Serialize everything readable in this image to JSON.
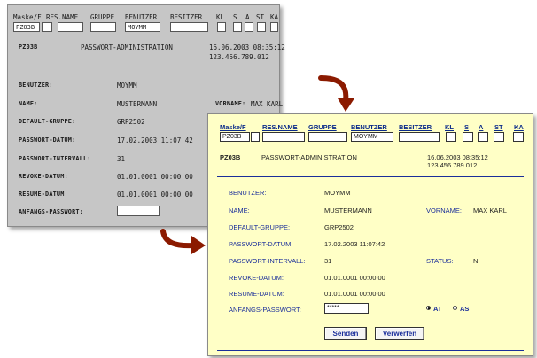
{
  "old_screen": {
    "header_labels": [
      "Maske/F",
      "RES.NAME",
      "GRUPPE",
      "BENUTZER",
      "BESITZER",
      "KL",
      "S",
      "A",
      "ST",
      "KA"
    ],
    "maske_value": "PZ03B",
    "benutzer_value": "MOYMM",
    "mask_code": "PZ03B",
    "title": "PASSWORT-ADMINISTRATION",
    "datetime": "16.06.2003 08:35:12",
    "ip": "123.456.789.012",
    "labels": {
      "benutzer": "BENUTZER:",
      "name": "NAME:",
      "vorname": "VORNAME:",
      "default_gruppe": "DEFAULT-GRUPPE:",
      "passwort_datum": "PASSWORT-DATUM:",
      "passwort_intervall": "PASSWORT-INTERVALL:",
      "revoke_datum": "REVOKE-DATUM:",
      "resume_datum": "RESUME-DATUM",
      "anfangs_passwort": "ANFANGS-PASSWORT:"
    },
    "values": {
      "benutzer": "MOYMM",
      "name": "MUSTERMANN",
      "vorname": "MAX KARL",
      "default_gruppe": "GRP2502",
      "passwort_datum": "17.02.2003 11:07:42",
      "passwort_intervall": "31",
      "revoke_datum": "01.01.0001 00:00:00",
      "resume_datum": "01.01.0001 00:00:00"
    }
  },
  "new_screen": {
    "header_labels": [
      "Maske/F",
      "RES.NAME",
      "GRUPPE",
      "BENUTZER",
      "BESITZER",
      "KL",
      "S",
      "A",
      "ST",
      "KA"
    ],
    "maske_value": "PZ03B",
    "benutzer_value": "MOYMM",
    "mask_code": "PZ03B",
    "title": "PASSWORT-ADMINISTRATION",
    "datetime": "16.06.2003 08:35:12",
    "ip": "123.456.789.012",
    "labels": {
      "benutzer": "BENUTZER:",
      "name": "NAME:",
      "vorname": "VORNAME:",
      "default_gruppe": "DEFAULT-GRUPPE:",
      "passwort_datum": "PASSWORT-DATUM:",
      "passwort_intervall": "PASSWORT-INTERVALL:",
      "status": "STATUS:",
      "revoke_datum": "REVOKE-DATUM:",
      "resume_datum": "RESUME-DATUM:",
      "anfangs_passwort": "ANFANGS-PASSWORT:"
    },
    "values": {
      "benutzer": "MOYMM",
      "name": "MUSTERMANN",
      "vorname": "MAX KARL",
      "default_gruppe": "GRP2502",
      "passwort_datum": "17.02.2003 11:07:42",
      "passwort_intervall": "31",
      "status": "N",
      "revoke_datum": "01.01.0001 00:00:00",
      "resume_datum": "01.01.0001 00:00:00"
    },
    "password_field": "*****",
    "radio_options": [
      {
        "label": "AT",
        "selected": true
      },
      {
        "label": "AS",
        "selected": false
      }
    ],
    "buttons": {
      "send": "Senden",
      "discard": "Verwerfen"
    }
  },
  "colors": {
    "old_bg": "#c6c6c6",
    "new_bg": "#ffffc6",
    "label_blue": "#1a2e9a",
    "arrow": "#8b1a00"
  }
}
